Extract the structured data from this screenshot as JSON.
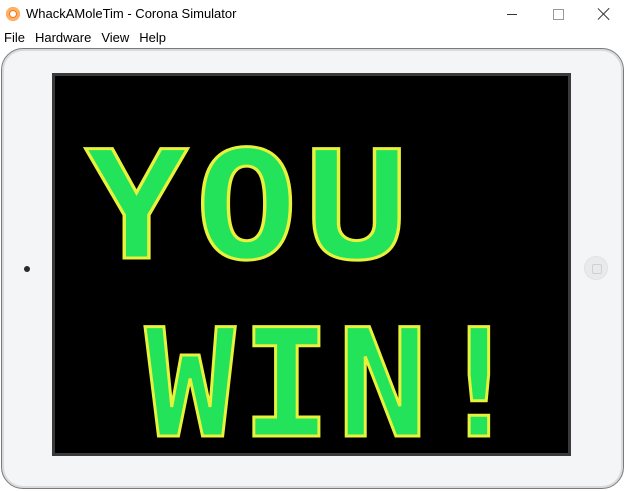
{
  "window": {
    "title": "WhackAMoleTim - Corona Simulator",
    "controls": {
      "minimize_icon": "minimize-icon",
      "maximize_icon": "maximize-icon",
      "close_icon": "close-icon"
    }
  },
  "menubar": {
    "items": [
      "File",
      "Hardware",
      "View",
      "Help"
    ]
  },
  "game": {
    "message_line1": "YOU",
    "message_line2": "WIN!",
    "colors": {
      "green": "#22e35a",
      "yellow": "#e9f23a",
      "background": "#000000"
    }
  },
  "device": {
    "camera_icon": "camera-icon",
    "home_button_icon": "home-button-icon"
  }
}
